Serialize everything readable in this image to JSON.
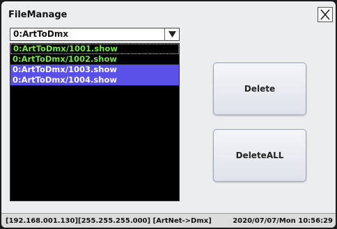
{
  "window": {
    "title": "FileManage"
  },
  "path_combo": {
    "value": "0:ArtToDmx"
  },
  "files": [
    {
      "name": "0:ArtToDmx/1001.show",
      "state": "focused"
    },
    {
      "name": "0:ArtToDmx/1002.show",
      "state": "normal"
    },
    {
      "name": "0:ArtToDmx/1003.show",
      "state": "selected"
    },
    {
      "name": "0:ArtToDmx/1004.show",
      "state": "selected"
    }
  ],
  "buttons": {
    "delete": "Delete",
    "delete_all": "DeleteALL"
  },
  "status_bar": {
    "network": "[192.168.001.130][255.255.255.000] [ArtNet->Dmx]",
    "datetime": "2020/07/07/Mon 10:56:29"
  },
  "colors": {
    "file_text": "#7be34e",
    "selection": "#5a4fe6",
    "list_background": "#000000"
  },
  "icons": {
    "close": "close-x-icon",
    "dropdown": "triangle-down-icon"
  }
}
